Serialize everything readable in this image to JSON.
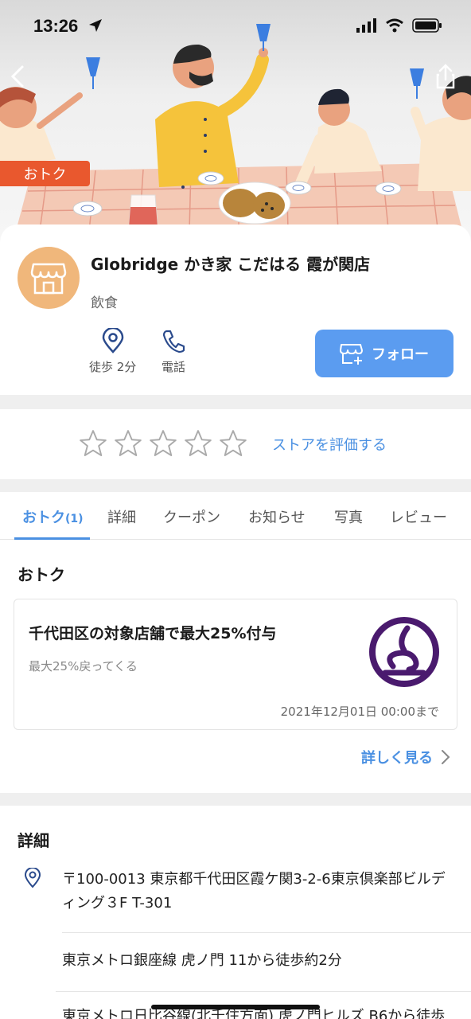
{
  "status_bar": {
    "time": "13:26"
  },
  "hero": {
    "deal_tag": "おトク"
  },
  "store": {
    "name": "Globridge かき家 こだはる 霞が関店",
    "category": "飲食",
    "walk_label": "徒歩 2分",
    "phone_label": "電話",
    "follow_label": "フォロー"
  },
  "rating": {
    "value": 0,
    "max": 5,
    "rate_link": "ストアを評価する"
  },
  "tabs": {
    "deals": "おトク",
    "deals_count": "(1)",
    "details": "詳細",
    "coupon": "クーポン",
    "news": "お知らせ",
    "photos": "写真",
    "reviews": "レビュー"
  },
  "deals_section": {
    "title": "おトク",
    "card": {
      "title": "千代田区の対象店舗で最大25%付与",
      "subtitle": "最大25%戻ってくる",
      "expires": "2021年12月01日 00:00まで"
    },
    "more_link": "詳しく見る"
  },
  "details_section": {
    "title": "詳細",
    "address": "〒100-0013 東京都千代田区霞ケ関3-2-6東京倶楽部ビルディング３F T-301",
    "access_1": "東京メトロ銀座線 虎ノ門 11から徒歩約2分",
    "access_2": "東京メトロ日比谷線(北千住方面) 虎ノ門ヒルズ B6から徒歩"
  },
  "colors": {
    "accent": "#4a90e2",
    "follow": "#5b9cf0",
    "deal_tag": "#e9582e",
    "avatar": "#f0b77b"
  }
}
